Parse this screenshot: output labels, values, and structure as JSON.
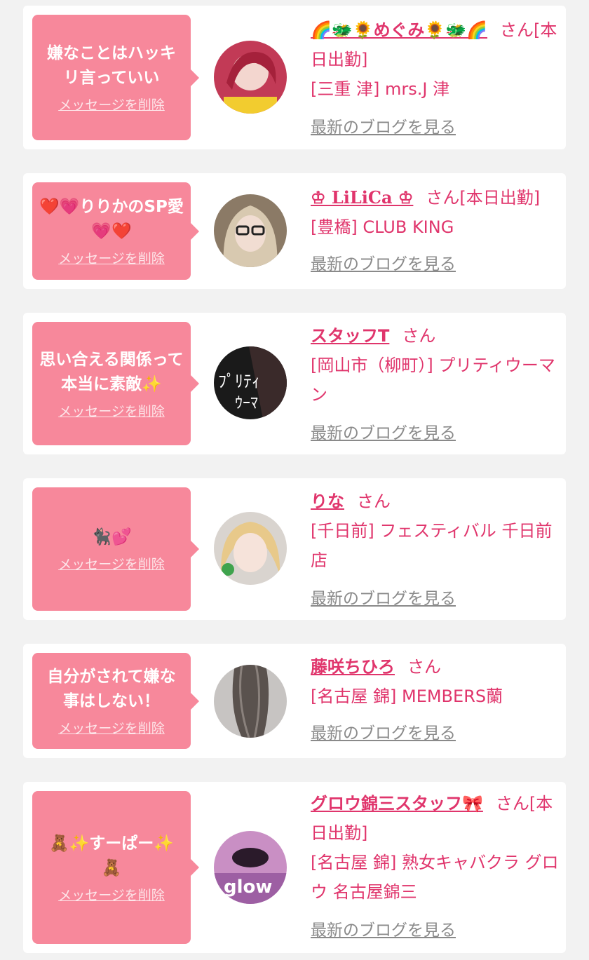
{
  "cards": [
    {
      "message": "嫌なことはハッキリ言っていい",
      "delete_label": "メッセージを削除",
      "name": "🌈🐲🌻めぐみ🌻🐲🌈",
      "honorific": "さん",
      "status": "[本日出勤]",
      "shop": "[三重 津] mrs.J 津",
      "blog_label": "最新のブログを見る"
    },
    {
      "message": "❤️💗りりかのSP愛💗❤️",
      "delete_label": "メッセージを削除",
      "name": "♔ LiLiCa ♔",
      "honorific": "さん",
      "status": "[本日出勤]",
      "shop": "[豊橋] CLUB KING",
      "blog_label": "最新のブログを見る"
    },
    {
      "message": "思い合える関係って本当に素敵✨",
      "delete_label": "メッセージを削除",
      "name": "スタッフT",
      "honorific": "さん",
      "status": "",
      "shop": "[岡山市（柳町）] プリティウーマン",
      "blog_label": "最新のブログを見る"
    },
    {
      "message": "🐈‍⬛💕",
      "delete_label": "メッセージを削除",
      "name": "りな",
      "honorific": "さん",
      "status": "",
      "shop": "[千日前] フェスティバル 千日前店",
      "blog_label": "最新のブログを見る"
    },
    {
      "message": "自分がされて嫌な事はしない！",
      "delete_label": "メッセージを削除",
      "name": "藤咲ちひろ",
      "honorific": "さん",
      "status": "",
      "shop": "[名古屋 錦] MEMBERS蘭",
      "blog_label": "最新のブログを見る"
    },
    {
      "message": "🧸✨すーぱー✨🧸",
      "delete_label": "メッセージを削除",
      "name": "グロウ錦三スタッフ🎀",
      "honorific": "さん",
      "status": "[本日出勤]",
      "shop": "[名古屋 錦] 熟女キャバクラ グロウ 名古屋錦三",
      "blog_label": "最新のブログを見る"
    }
  ],
  "colors": {
    "accent": "#e0356c",
    "bubble": "#f7889b",
    "background": "#f2f2f2",
    "link_gray": "#8a8a8a"
  }
}
